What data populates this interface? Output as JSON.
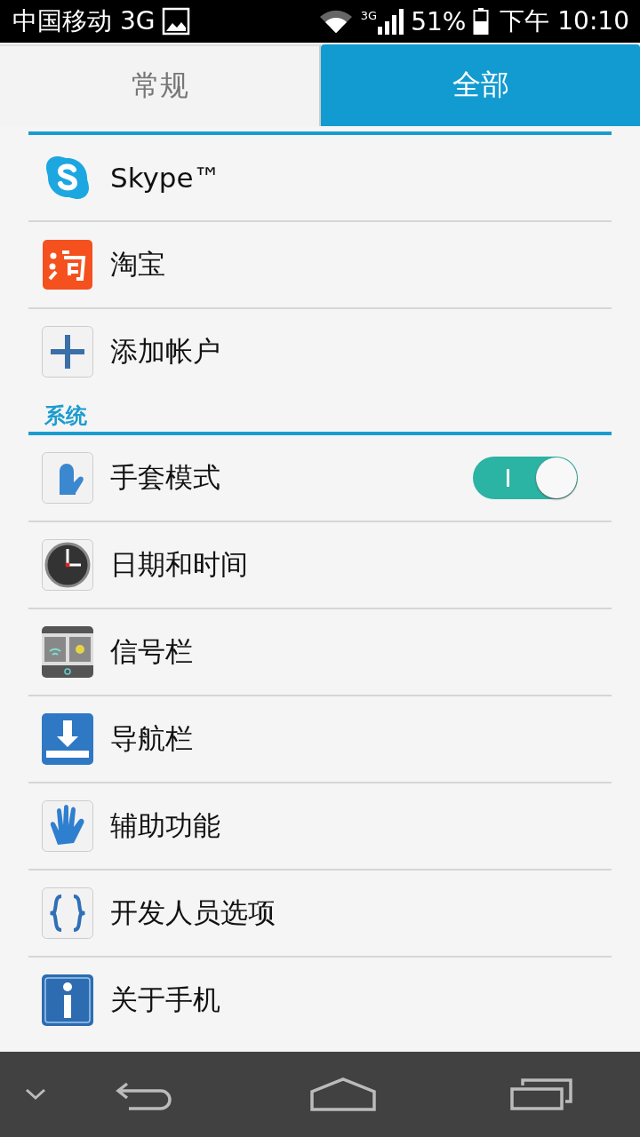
{
  "status_bar": {
    "carrier": "中国移动 3G",
    "network": "3G",
    "battery": "51%",
    "time": "下午 10:10"
  },
  "tabs": [
    {
      "label": "常规",
      "selected": false
    },
    {
      "label": "全部",
      "selected": true
    }
  ],
  "accounts": {
    "items": [
      {
        "label": "Skype™"
      },
      {
        "label": "淘宝"
      },
      {
        "label": "添加帐户"
      }
    ]
  },
  "system": {
    "title": "系统",
    "items": [
      {
        "label": "手套模式",
        "kind": "toggle",
        "on": true
      },
      {
        "label": "日期和时间",
        "kind": "plain"
      },
      {
        "label": "信号栏",
        "kind": "plain"
      },
      {
        "label": "导航栏",
        "kind": "plain"
      },
      {
        "label": "辅助功能",
        "kind": "plain"
      },
      {
        "label": "开发人员选项",
        "kind": "plain"
      },
      {
        "label": "关于手机",
        "kind": "plain"
      }
    ]
  }
}
